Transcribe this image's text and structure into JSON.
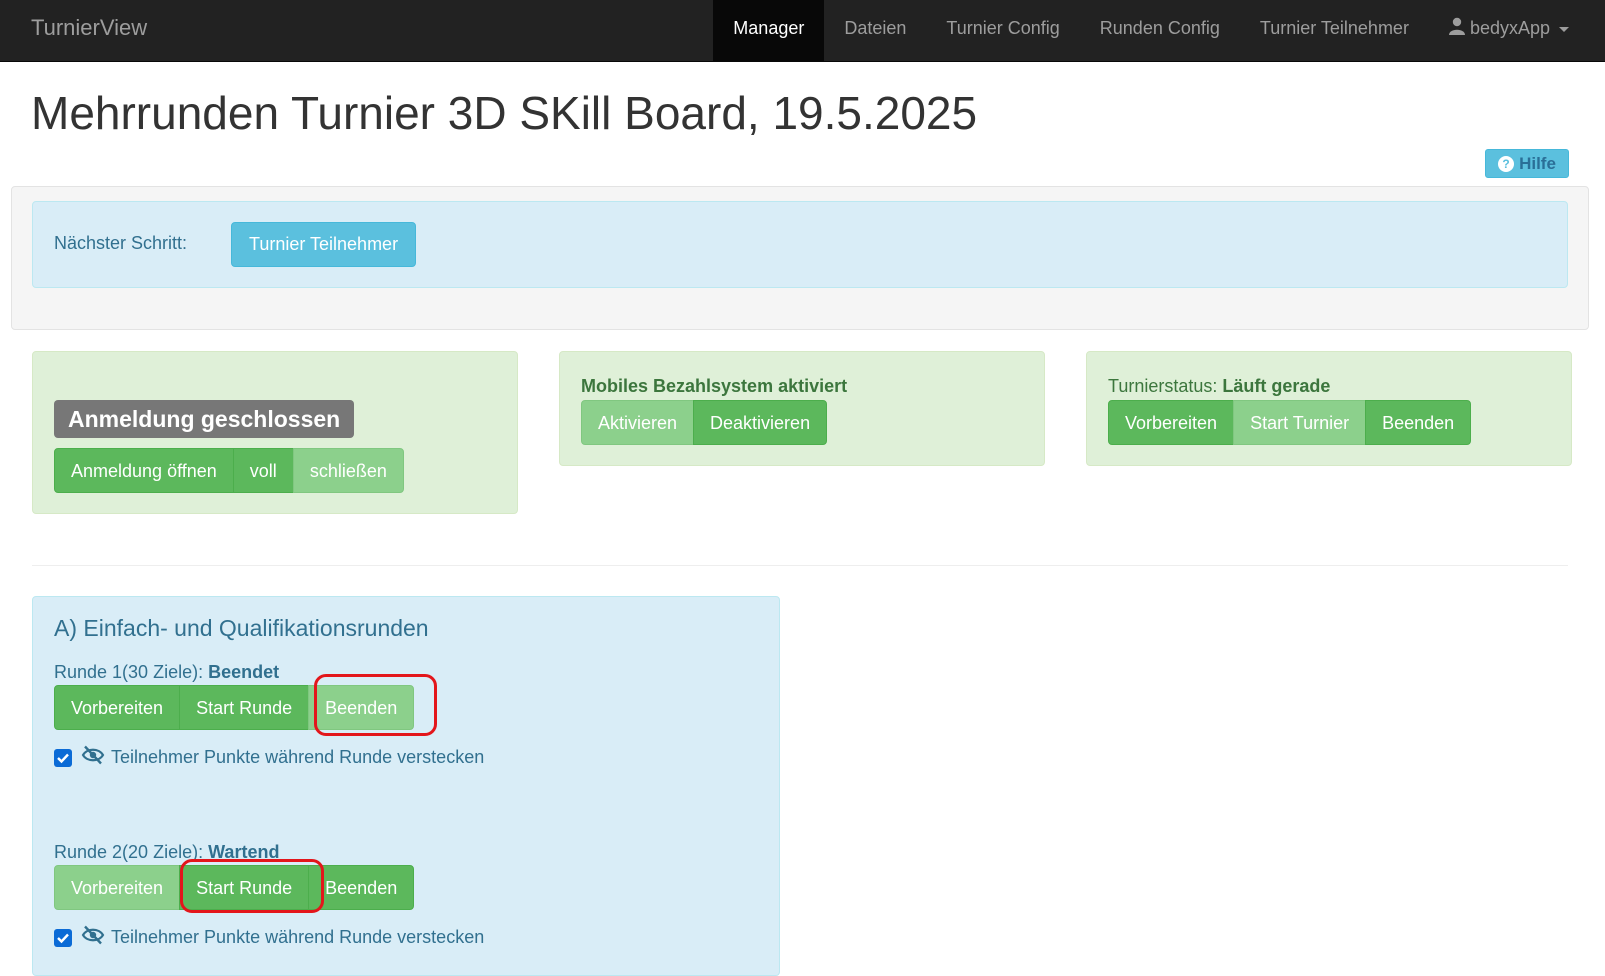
{
  "navbar": {
    "brand": "TurnierView",
    "items": [
      "Manager",
      "Dateien",
      "Turnier Config",
      "Runden Config",
      "Turnier Teilnehmer"
    ],
    "active": "Manager",
    "user": "bedyxApp"
  },
  "page": {
    "title": "Mehrrunden Turnier 3D SKill Board, 19.5.2025",
    "help_label": "Hilfe"
  },
  "next_step": {
    "label": "Nächster Schritt:",
    "button": "Turnier Teilnehmer"
  },
  "registration": {
    "status": "Anmeldung geschlossen",
    "buttons": [
      "Anmeldung öffnen",
      "voll",
      "schließen"
    ],
    "active_button": "schließen"
  },
  "payment": {
    "title": "Mobiles Bezahlsystem aktiviert",
    "buttons": [
      "Aktivieren",
      "Deaktivieren"
    ],
    "active_button": "Aktivieren"
  },
  "tournament_status": {
    "label": "Turnierstatus:",
    "value": "Läuft gerade",
    "buttons": [
      "Vorbereiten",
      "Start Turnier",
      "Beenden"
    ],
    "active_button": "Start Turnier"
  },
  "rounds": {
    "title": "A) Einfach- und Qualifikationsrunden",
    "items": [
      {
        "label": "Runde 1(30 Ziele):",
        "status": "Beendet",
        "buttons": [
          "Vorbereiten",
          "Start Runde",
          "Beenden"
        ],
        "active_button": "Beenden",
        "hide_points_label": "Teilnehmer Punkte während Runde verstecken",
        "hide_points_checked": true
      },
      {
        "label": "Runde 2(20 Ziele):",
        "status": "Wartend",
        "buttons": [
          "Vorbereiten",
          "Start Runde",
          "Beenden"
        ],
        "active_button": "Vorbereiten",
        "hide_points_label": "Teilnehmer Punkte während Runde verstecken",
        "hide_points_checked": true
      }
    ]
  },
  "colors": {
    "navbar_bg": "#222222",
    "success": "#5cb85c",
    "success_active": "#8cd08c",
    "info": "#5bc0de",
    "highlight": "#e3161b"
  },
  "icons": [
    "user-icon",
    "caret-down-icon",
    "question-circle-icon",
    "checkbox-checked-icon",
    "eye-slash-icon"
  ]
}
